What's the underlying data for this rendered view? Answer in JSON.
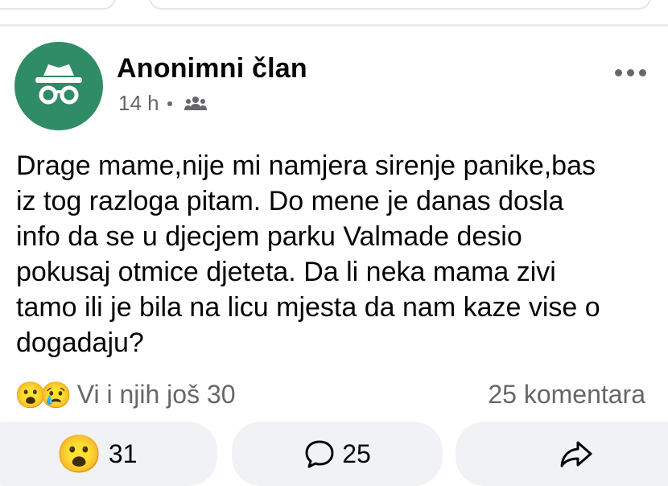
{
  "post": {
    "author": "Anonimni član",
    "time": "14 h",
    "text": "Drage mame,nije mi namjera sirenje panike,bas\niz tog razloga pitam. Do mene je danas dosla\ninfo da se u djecjem parku Valmade desio\npokusaj otmice djeteta. Da li neka mama zivi\ntamo ili je bila na licu mjesta da nam kaze vise o\ndogadaju?"
  },
  "reactions": {
    "emoji_1": "😮",
    "emoji_2": "😢",
    "summary": "Vi i njih još 30",
    "comments_label": "25 komentara"
  },
  "actions": {
    "react_emoji": "😮",
    "react_count": "31",
    "comment_count": "25"
  },
  "icons": [
    "incognito-avatar-icon",
    "group-audience-icon",
    "more-dots-icon",
    "comment-icon",
    "share-icon"
  ],
  "colors": {
    "avatar_bg": "#2f8c66",
    "secondary_text": "#65676b",
    "button_bg": "#f0f2f5"
  }
}
